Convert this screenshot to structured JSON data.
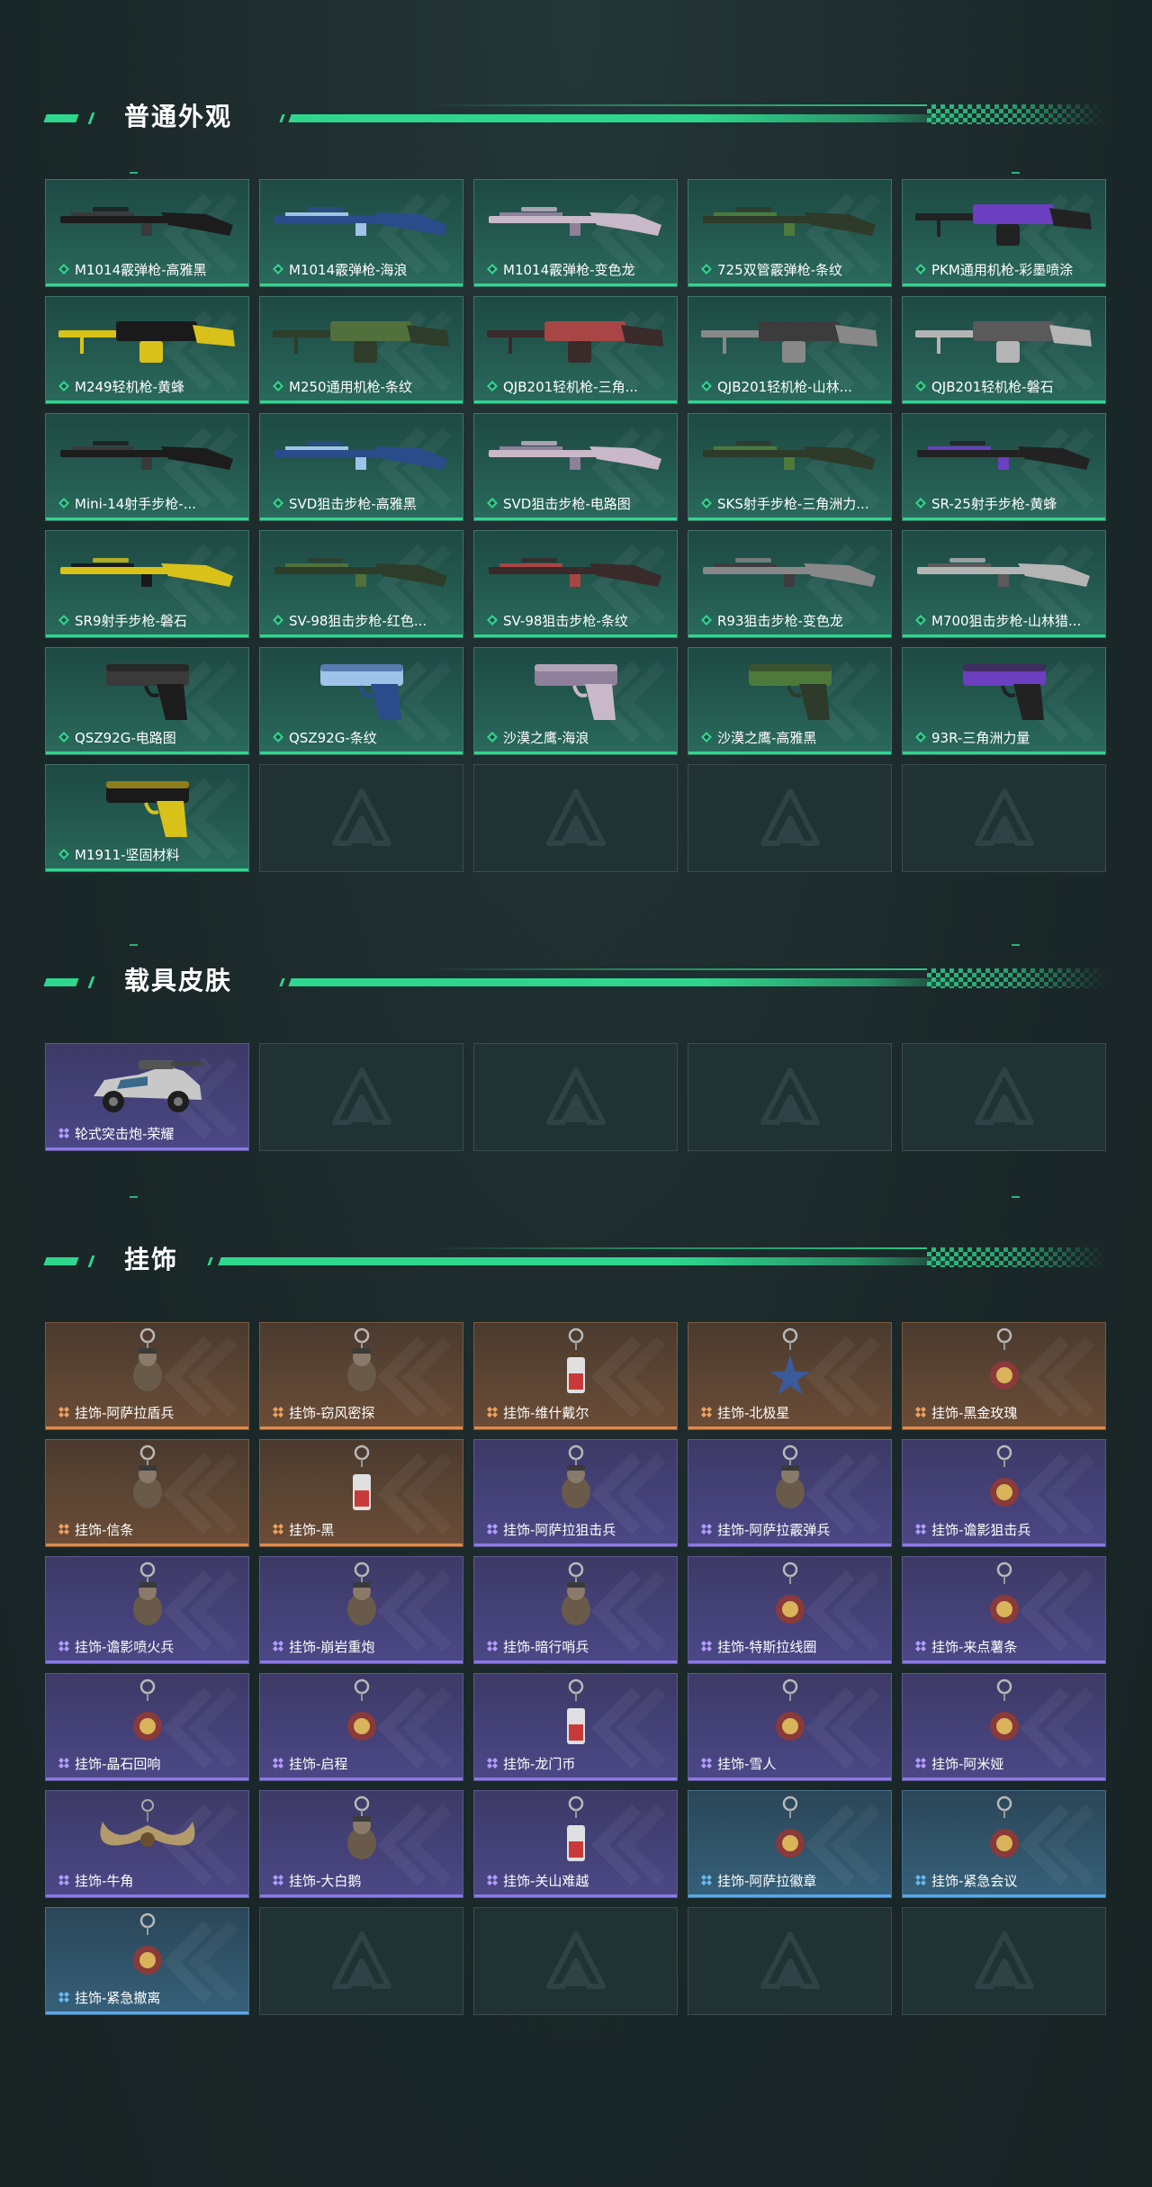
{
  "colors": {
    "accent": "#2fd68e",
    "rarity_green": "#2fd68e",
    "rarity_purple": "#8d78e6",
    "rarity_orange": "#e08a4a",
    "rarity_blue": "#5aa8e8"
  },
  "sections": {
    "normal": {
      "title": "普通外观",
      "items": [
        {
          "label": "M1014霰弹枪-高雅黑",
          "rarity": "green",
          "icon": "shotgun"
        },
        {
          "label": "M1014霰弹枪-海浪",
          "rarity": "green",
          "icon": "shotgun"
        },
        {
          "label": "M1014霰弹枪-变色龙",
          "rarity": "green",
          "icon": "shotgun"
        },
        {
          "label": "725双管霰弹枪-条纹",
          "rarity": "green",
          "icon": "shotgun"
        },
        {
          "label": "PKM通用机枪-彩墨喷涂",
          "rarity": "green",
          "icon": "machine-gun"
        },
        {
          "label": "M249轻机枪-黄蜂",
          "rarity": "green",
          "icon": "machine-gun"
        },
        {
          "label": "M250通用机枪-条纹",
          "rarity": "green",
          "icon": "machine-gun"
        },
        {
          "label": "QJB201轻机枪-三角...",
          "rarity": "green",
          "icon": "machine-gun"
        },
        {
          "label": "QJB201轻机枪-山林...",
          "rarity": "green",
          "icon": "machine-gun"
        },
        {
          "label": "QJB201轻机枪-磐石",
          "rarity": "green",
          "icon": "machine-gun"
        },
        {
          "label": "Mini-14射手步枪-...",
          "rarity": "green",
          "icon": "rifle"
        },
        {
          "label": "SVD狙击步枪-高雅黑",
          "rarity": "green",
          "icon": "rifle"
        },
        {
          "label": "SVD狙击步枪-电路图",
          "rarity": "green",
          "icon": "rifle"
        },
        {
          "label": "SKS射手步枪-三角洲力...",
          "rarity": "green",
          "icon": "rifle"
        },
        {
          "label": "SR-25射手步枪-黄蜂",
          "rarity": "green",
          "icon": "rifle"
        },
        {
          "label": "SR9射手步枪-磐石",
          "rarity": "green",
          "icon": "rifle"
        },
        {
          "label": "SV-98狙击步枪-红色...",
          "rarity": "green",
          "icon": "rifle"
        },
        {
          "label": "SV-98狙击步枪-条纹",
          "rarity": "green",
          "icon": "rifle"
        },
        {
          "label": "R93狙击步枪-变色龙",
          "rarity": "green",
          "icon": "rifle"
        },
        {
          "label": "M700狙击步枪-山林猎...",
          "rarity": "green",
          "icon": "rifle"
        },
        {
          "label": "QSZ92G-电路图",
          "rarity": "green",
          "icon": "pistol"
        },
        {
          "label": "QSZ92G-条纹",
          "rarity": "green",
          "icon": "pistol"
        },
        {
          "label": "沙漠之鹰-海浪",
          "rarity": "green",
          "icon": "pistol"
        },
        {
          "label": "沙漠之鹰-高雅黑",
          "rarity": "green",
          "icon": "pistol"
        },
        {
          "label": "93R-三角洲力量",
          "rarity": "green",
          "icon": "pistol"
        },
        {
          "label": "M1911-坚固材料",
          "rarity": "green",
          "icon": "pistol"
        }
      ],
      "empty_slots": 4
    },
    "vehicle": {
      "title": "载具皮肤",
      "items": [
        {
          "label": "轮式突击炮-荣耀",
          "rarity": "purple",
          "icon": "vehicle"
        }
      ],
      "empty_slots": 4
    },
    "charm": {
      "title": "挂饰",
      "items": [
        {
          "label": "挂饰-阿萨拉盾兵",
          "rarity": "orange",
          "icon": "figure-charm"
        },
        {
          "label": "挂饰-窃风密探",
          "rarity": "orange",
          "icon": "figure-charm"
        },
        {
          "label": "挂饰-维什戴尔",
          "rarity": "orange",
          "icon": "tag-charm"
        },
        {
          "label": "挂饰-北极星",
          "rarity": "orange",
          "icon": "star-charm"
        },
        {
          "label": "挂饰-黑金玫瑰",
          "rarity": "orange",
          "icon": "ring-charm"
        },
        {
          "label": "挂饰-信条",
          "rarity": "orange",
          "icon": "figure-charm"
        },
        {
          "label": "挂饰-黑",
          "rarity": "orange",
          "icon": "tag-charm"
        },
        {
          "label": "挂饰-阿萨拉狙击兵",
          "rarity": "purple",
          "icon": "figure-charm"
        },
        {
          "label": "挂饰-阿萨拉霰弹兵",
          "rarity": "purple",
          "icon": "figure-charm"
        },
        {
          "label": "挂饰-谵影狙击兵",
          "rarity": "purple",
          "icon": "ring-charm"
        },
        {
          "label": "挂饰-谵影喷火兵",
          "rarity": "purple",
          "icon": "figure-charm"
        },
        {
          "label": "挂饰-崩岩重炮",
          "rarity": "purple",
          "icon": "figure-charm"
        },
        {
          "label": "挂饰-暗行哨兵",
          "rarity": "purple",
          "icon": "figure-charm"
        },
        {
          "label": "挂饰-特斯拉线圈",
          "rarity": "purple",
          "icon": "ring-charm"
        },
        {
          "label": "挂饰-来点薯条",
          "rarity": "purple",
          "icon": "ring-charm"
        },
        {
          "label": "挂饰-晶石回响",
          "rarity": "purple",
          "icon": "ring-charm"
        },
        {
          "label": "挂饰-启程",
          "rarity": "purple",
          "icon": "ring-charm"
        },
        {
          "label": "挂饰-龙门币",
          "rarity": "purple",
          "icon": "tag-charm"
        },
        {
          "label": "挂饰-雪人",
          "rarity": "purple",
          "icon": "ring-charm"
        },
        {
          "label": "挂饰-阿米娅",
          "rarity": "purple",
          "icon": "ring-charm"
        },
        {
          "label": "挂饰-牛角",
          "rarity": "purple",
          "icon": "horn-charm"
        },
        {
          "label": "挂饰-大白鹅",
          "rarity": "purple",
          "icon": "figure-charm"
        },
        {
          "label": "挂饰-关山难越",
          "rarity": "purple",
          "icon": "tag-charm"
        },
        {
          "label": "挂饰-阿萨拉徽章",
          "rarity": "blue",
          "icon": "ring-charm"
        },
        {
          "label": "挂饰-紧急会议",
          "rarity": "blue",
          "icon": "ring-charm"
        },
        {
          "label": "挂饰-紧急撤离",
          "rarity": "blue",
          "icon": "ring-charm"
        }
      ],
      "empty_slots": 4
    }
  }
}
